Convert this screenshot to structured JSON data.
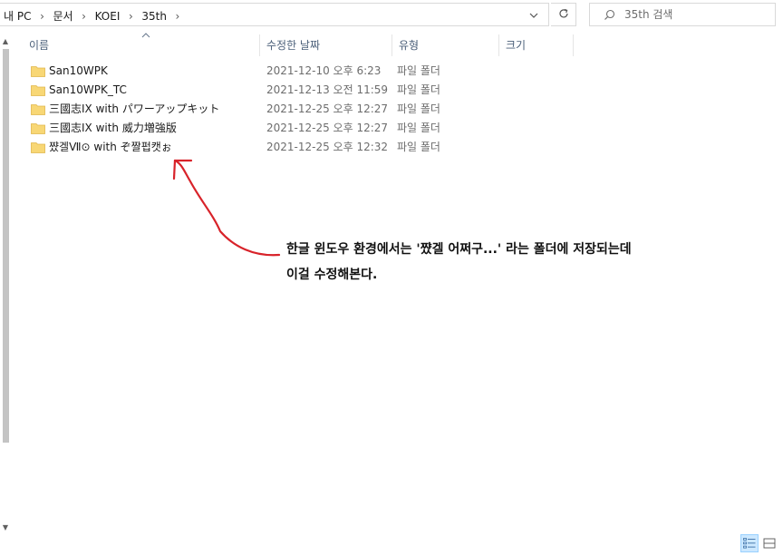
{
  "address_bar": {
    "breadcrumbs": [
      "내 PC",
      "문서",
      "KOEI",
      "35th"
    ]
  },
  "search": {
    "placeholder": "35th 검색"
  },
  "columns": [
    {
      "label": "이름"
    },
    {
      "label": "수정한 날짜"
    },
    {
      "label": "유형"
    },
    {
      "label": "크기"
    }
  ],
  "files": [
    {
      "name": "San10WPK",
      "modified": "2021-12-10 오후 6:23",
      "type": "파일 폴더"
    },
    {
      "name": "San10WPK_TC",
      "modified": "2021-12-13 오전 11:59",
      "type": "파일 폴더"
    },
    {
      "name": "三國志IX with パワーアップキット",
      "modified": "2021-12-25 오후 12:27",
      "type": "파일 폴더"
    },
    {
      "name": "三國志IX with 威力増強版",
      "modified": "2021-12-25 오후 12:27",
      "type": "파일 폴더"
    },
    {
      "name": "쨨겔Ⅶ⊙ with ぞ짤펍캣ぉ",
      "modified": "2021-12-25 오후 12:32",
      "type": "파일 폴더"
    }
  ],
  "annotation": {
    "line1": "한글 윈도우 환경에서는 '쨨겔 어쩌구...' 라는 폴더에 저장되는데",
    "line2": "이걸 수정해본다."
  },
  "colors": {
    "folder": "#f8d775",
    "header_text": "#4c607a",
    "annotation_arrow": "#d8232a",
    "selected_view": "#cce8ff"
  },
  "icons": {
    "breadcrumb_separator": "chevron-right-icon",
    "address_dropdown": "chevron-down-icon",
    "refresh": "refresh-icon",
    "search": "search-icon",
    "sort": "sort-up-icon",
    "folder": "folder-icon"
  }
}
